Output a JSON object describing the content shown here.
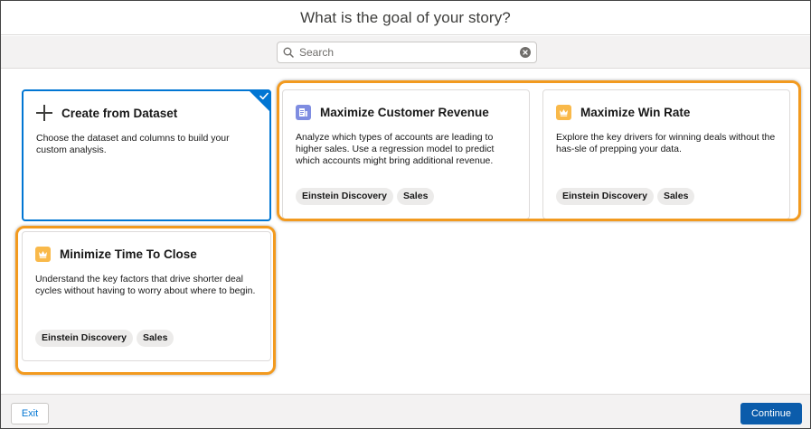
{
  "header": {
    "title": "What is the goal of your story?"
  },
  "search": {
    "placeholder": "Search",
    "value": ""
  },
  "cards": [
    {
      "title": "Create from Dataset",
      "description": "Choose the dataset and columns to build your custom analysis.",
      "icon": "plus-icon",
      "selected": true,
      "tags": []
    },
    {
      "title": "Maximize Customer Revenue",
      "description": "Analyze which types of accounts are leading to higher sales. Use a regression model to predict which accounts might bring additional revenue.",
      "icon": "report-icon",
      "tags": [
        "Einstein Discovery",
        "Sales"
      ]
    },
    {
      "title": "Maximize Win Rate",
      "description": "Explore the key drivers for winning deals without the has-sle of prepping your data.",
      "icon": "crown-icon",
      "tags": [
        "Einstein Discovery",
        "Sales"
      ]
    },
    {
      "title": "Minimize Time To Close",
      "description": "Understand the key factors that drive shorter deal cycles without having to worry about where to begin.",
      "icon": "crown-icon",
      "tags": [
        "Einstein Discovery",
        "Sales"
      ]
    }
  ],
  "footer": {
    "exit_label": "Exit",
    "continue_label": "Continue"
  },
  "colors": {
    "brand": "#0176d3",
    "highlight": "#f29a1f",
    "crown_icon_bg": "#f9b94a",
    "report_icon_bg": "#7f8de1"
  }
}
